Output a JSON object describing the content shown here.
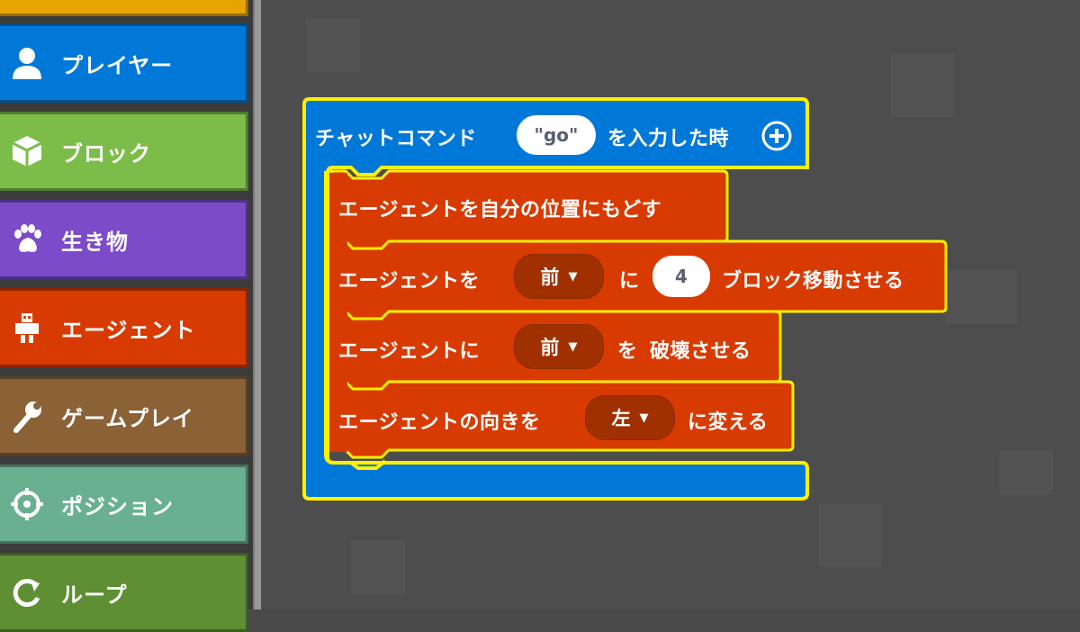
{
  "categories": [
    {
      "label": "プレイヤー",
      "color": "#0078d7",
      "icon": "person-icon"
    },
    {
      "label": "ブロック",
      "color": "#7cbd4a",
      "icon": "cube-icon"
    },
    {
      "label": "生き物",
      "color": "#7b4bca",
      "icon": "paw-icon"
    },
    {
      "label": "エージェント",
      "color": "#d83b01",
      "icon": "agent-icon"
    },
    {
      "label": "ゲームプレイ",
      "color": "#8b6136",
      "icon": "wrench-icon"
    },
    {
      "label": "ポジション",
      "color": "#69b090",
      "icon": "crosshair-icon"
    },
    {
      "label": "ループ",
      "color": "#5e8f34",
      "icon": "loop-icon"
    }
  ],
  "hat_block": {
    "prefix": "チャットコマンド",
    "command_value": "\"go\"",
    "suffix": "を入力した時",
    "color": "#0078d7",
    "add_icon": "plus-circle-icon"
  },
  "statements": [
    {
      "text": "エージェントを自分の位置にもどす"
    },
    {
      "prefix": "エージェントを",
      "direction": "前",
      "mid": "に",
      "number": "4",
      "suffix": "ブロック移動させる"
    },
    {
      "prefix": "エージェントに",
      "direction": "前",
      "mid": "を",
      "suffix": "破壊させる"
    },
    {
      "prefix": "エージェントの向きを",
      "direction": "左",
      "suffix": "に変える"
    }
  ],
  "colors": {
    "agent_block": "#d83b01",
    "highlight": "#ffef00",
    "workspace": "#4d4d4d"
  }
}
